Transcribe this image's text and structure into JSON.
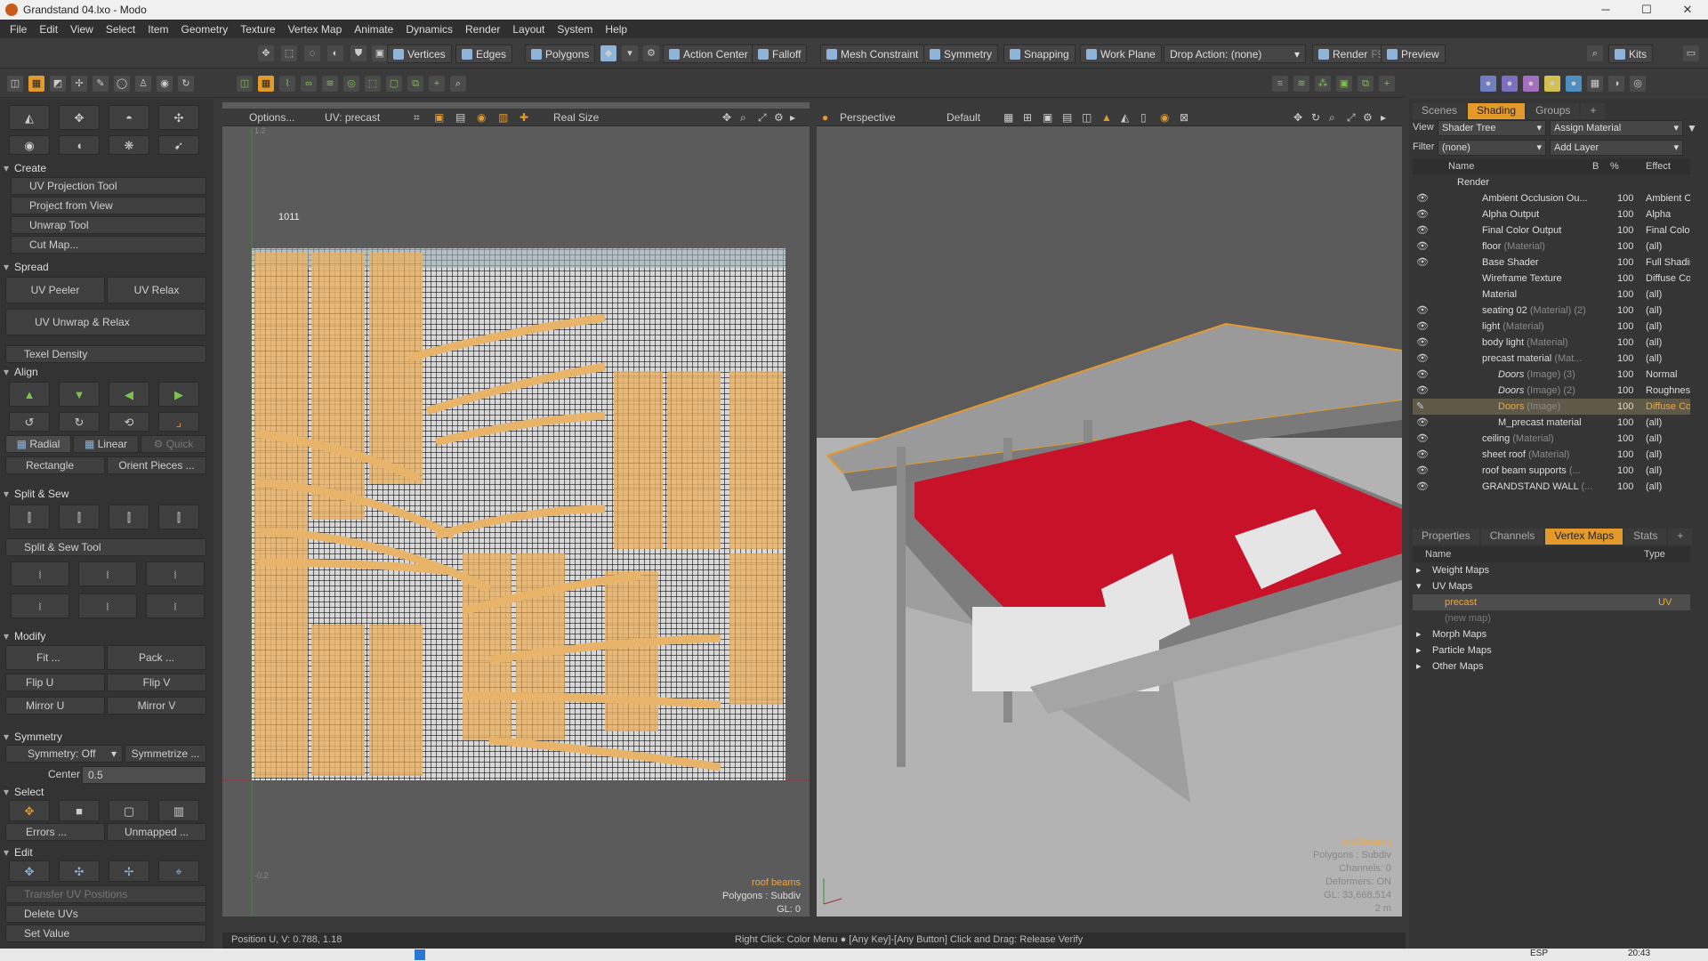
{
  "window": {
    "title": "Grandstand 04.lxo - Modo",
    "min": "─",
    "max": "☐",
    "close": "✕"
  },
  "menu": [
    "File",
    "Edit",
    "View",
    "Select",
    "Item",
    "Geometry",
    "Texture",
    "Vertex Map",
    "Animate",
    "Dynamics",
    "Render",
    "Layout",
    "System",
    "Help"
  ],
  "toolbar": {
    "vertices": "Vertices",
    "edges": "Edges",
    "polygons": "Polygons",
    "action_center": "Action Center",
    "falloff": "Falloff",
    "mesh_constraint": "Mesh Constraint",
    "symmetry": "Symmetry",
    "snapping": "Snapping",
    "work_plane": "Work Plane",
    "drop_action": "Drop Action: (none)",
    "render": "Render",
    "render_key": "F9",
    "preview": "Preview",
    "kits": "Kits"
  },
  "left": {
    "create": "Create",
    "uv_projection": "UV Projection Tool",
    "project_from_view": "Project from View",
    "unwrap": "Unwrap Tool",
    "cut_map": "Cut Map...",
    "spread": "Spread",
    "uv_peeler": "UV Peeler",
    "uv_relax": "UV Relax",
    "uv_unwrap_relax": "UV Unwrap & Relax",
    "texel_density": "Texel Density",
    "align": "Align",
    "radial": "Radial",
    "linear": "Linear",
    "quick": "Quick",
    "rectangle": "Rectangle",
    "orient_pieces": "Orient Pieces ...",
    "split_sew": "Split & Sew",
    "split_sew_tool": "Split & Sew Tool",
    "modify": "Modify",
    "fit": "Fit ...",
    "pack": "Pack ...",
    "flip_u": "Flip U",
    "flip_v": "Flip V",
    "mirror_u": "Mirror U",
    "mirror_v": "Mirror V",
    "symmetry": "Symmetry",
    "symmetry_off": "Symmetry: Off",
    "symmetrize": "Symmetrize ...",
    "center_label": "Center",
    "center_value": "0.5",
    "select": "Select",
    "errors": "Errors ...",
    "unmapped": "Unmapped ...",
    "edit": "Edit",
    "transfer_uv": "Transfer UV Positions",
    "delete_uvs": "Delete UVs",
    "set_value": "Set Value"
  },
  "uv": {
    "options": "Options...",
    "uv_name": "UV: precast",
    "real_size": "Real Size",
    "tile_label": "1011",
    "tick_top": "1.2",
    "tick_bottom": "-0.2",
    "overlay_item": "roof beams",
    "overlay_poly": "Polygons : Subdiv",
    "overlay_gl": "GL: 0"
  },
  "viewport": {
    "perspective": "Perspective",
    "default": "Default",
    "overlay_item": "roof beams",
    "overlay_poly": "Polygons : Subdiv",
    "overlay_ch": "Channels: 0",
    "overlay_def": "Deformers: ON",
    "overlay_gl": "GL: 33,668,514",
    "overlay_m": "2 m"
  },
  "shading": {
    "tabs": [
      "Scenes",
      "Shading",
      "Groups"
    ],
    "view_label": "View",
    "view_value": "Shader Tree",
    "assign": "Assign Material",
    "filter_label": "Filter",
    "filter_value": "(none)",
    "add_layer": "Add Layer",
    "col_name": "Name",
    "col_b": "B",
    "col_pct": "%",
    "col_effect": "Effect",
    "rows": [
      {
        "name": "Render",
        "tag": "",
        "pct": "",
        "effect": ""
      },
      {
        "name": "Ambient Occlusion Ou...",
        "tag": "",
        "pct": "100",
        "effect": "Ambient O"
      },
      {
        "name": "Alpha Output",
        "tag": "",
        "pct": "100",
        "effect": "Alpha"
      },
      {
        "name": "Final Color Output",
        "tag": "",
        "pct": "100",
        "effect": "Final Color"
      },
      {
        "name": "floor",
        "tag": "(Material)",
        "pct": "100",
        "effect": "(all)"
      },
      {
        "name": "Base Shader",
        "tag": "",
        "pct": "100",
        "effect": "Full Shadin"
      },
      {
        "name": "Wireframe Texture",
        "tag": "",
        "pct": "100",
        "effect": "Diffuse Co"
      },
      {
        "name": "Material",
        "tag": "",
        "pct": "100",
        "effect": "(all)"
      },
      {
        "name": "seating 02",
        "tag": "(Material) (2)",
        "pct": "100",
        "effect": "(all)"
      },
      {
        "name": "light",
        "tag": "(Material)",
        "pct": "100",
        "effect": "(all)"
      },
      {
        "name": "body light",
        "tag": "(Material)",
        "pct": "100",
        "effect": "(all)"
      },
      {
        "name": "precast material",
        "tag": "(Mat...",
        "pct": "100",
        "effect": "(all)"
      },
      {
        "name": "Doors",
        "tag": "(Image) (3)",
        "pct": "100",
        "effect": "Normal"
      },
      {
        "name": "Doors",
        "tag": "(Image) (2)",
        "pct": "100",
        "effect": "Roughness"
      },
      {
        "name": "Doors",
        "tag": "(Image)",
        "pct": "100",
        "effect": "Diffuse Co"
      },
      {
        "name": "M_precast material",
        "tag": "",
        "pct": "100",
        "effect": "(all)"
      },
      {
        "name": "ceiling",
        "tag": "(Material)",
        "pct": "100",
        "effect": "(all)"
      },
      {
        "name": "sheet roof",
        "tag": "(Material)",
        "pct": "100",
        "effect": "(all)"
      },
      {
        "name": "roof beam supports",
        "tag": "(...",
        "pct": "100",
        "effect": "(all)"
      },
      {
        "name": "GRANDSTAND WALL",
        "tag": "(...",
        "pct": "100",
        "effect": "(all)"
      }
    ]
  },
  "vmaps": {
    "tabs": [
      "Properties",
      "Channels",
      "Vertex Maps",
      "Stats"
    ],
    "col_name": "Name",
    "col_type": "Type",
    "rows": [
      {
        "name": "Weight Maps",
        "type": ""
      },
      {
        "name": "UV Maps",
        "type": ""
      },
      {
        "name": "precast",
        "type": "UV"
      },
      {
        "name": "(new map)",
        "type": ""
      },
      {
        "name": "Morph Maps",
        "type": ""
      },
      {
        "name": "Particle Maps",
        "type": ""
      },
      {
        "name": "Other Maps",
        "type": ""
      }
    ]
  },
  "status": {
    "position": "Position U, V:  0.788, 1.18",
    "hint": "Right Click: Color Menu ● [Any Key]-[Any Button] Click and Drag: Release Verify"
  },
  "taskbar": {
    "lang": "ESP",
    "time": "20:43"
  },
  "colors": {
    "accent": "#e39a2b",
    "seats": "#c8122a",
    "uv_island": "#e8b46a"
  }
}
